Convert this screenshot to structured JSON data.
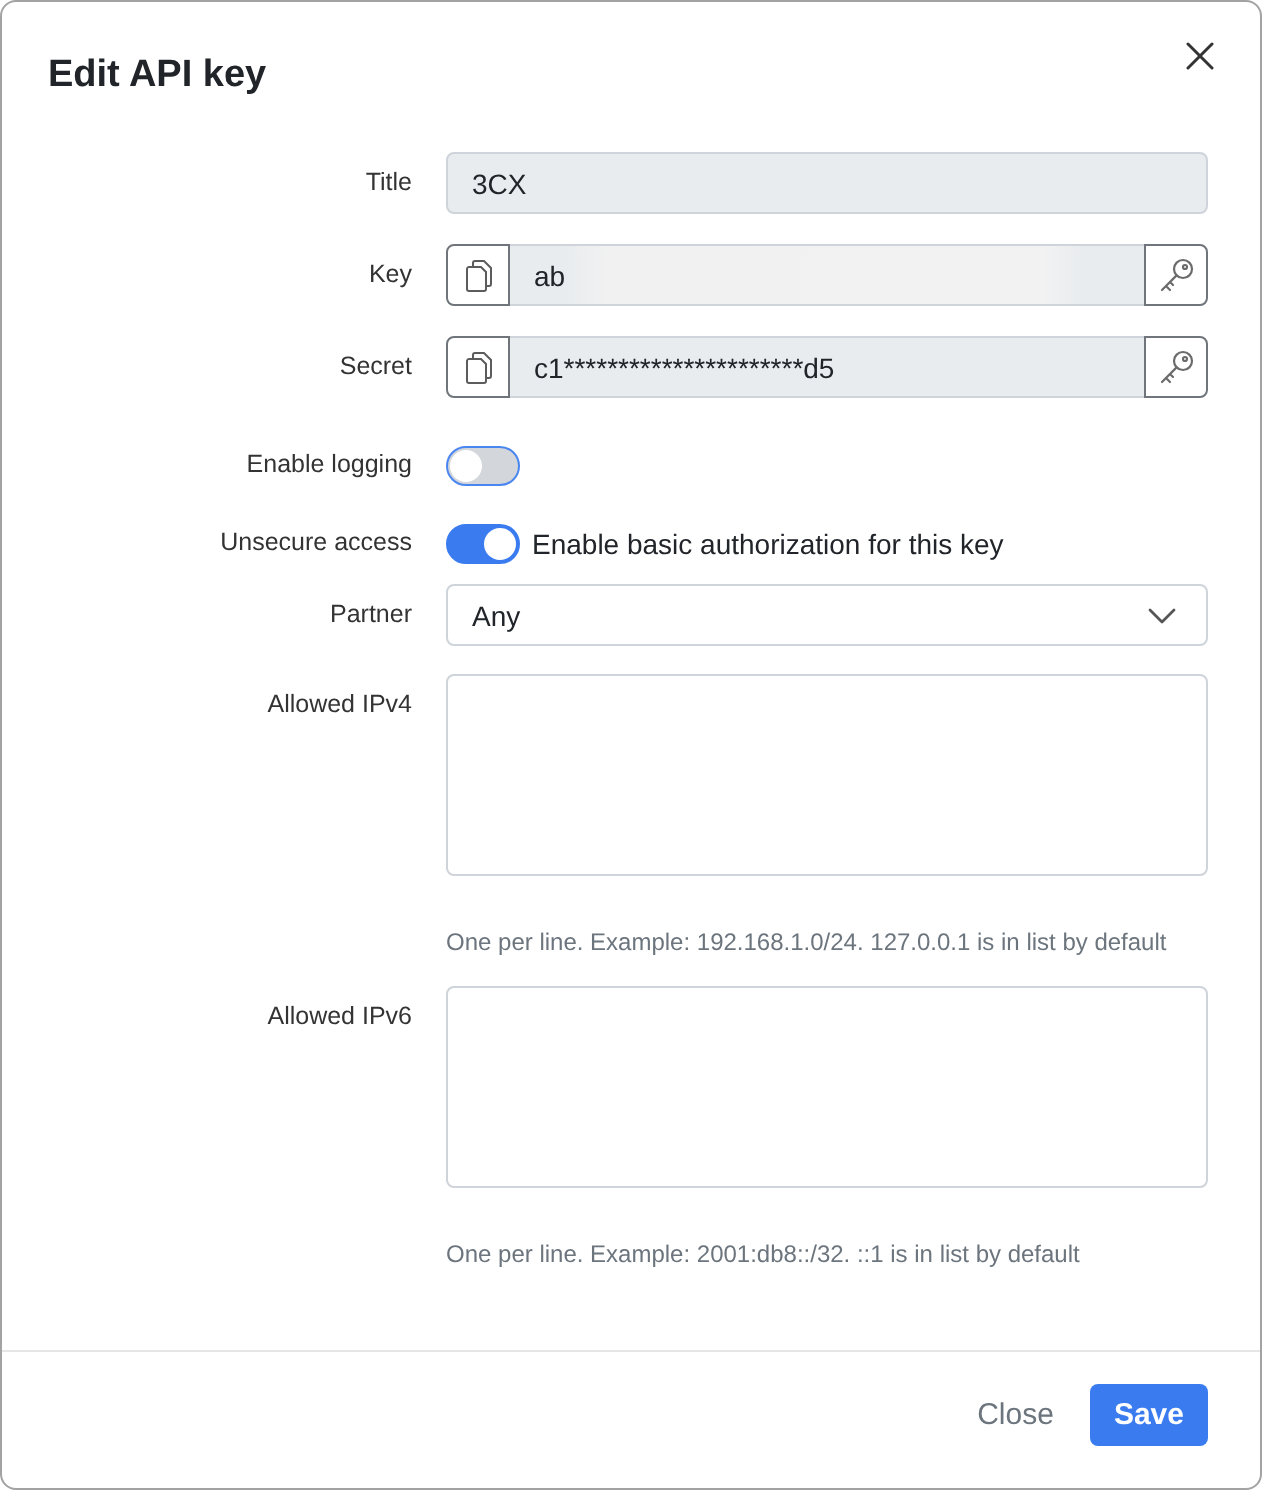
{
  "dialog": {
    "title": "Edit API key"
  },
  "fields": [
    {
      "kind": "text",
      "label": "Title",
      "value": "3CX",
      "disabled": true
    },
    {
      "kind": "secret",
      "label": "Key",
      "value": "ab",
      "disabled": true,
      "redacted": true
    },
    {
      "kind": "secret",
      "label": "Secret",
      "value": "c1**********************d5",
      "disabled": true
    },
    {
      "kind": "toggle",
      "label": "Enable logging",
      "on": false
    },
    {
      "kind": "toggle",
      "label": "Unsecure access",
      "on": true,
      "caption": "Enable basic authorization for this key"
    },
    {
      "kind": "select",
      "label": "Partner",
      "value": "Any"
    },
    {
      "kind": "textarea",
      "label": "Allowed IPv4",
      "help": "One per line. Example: 192.168.1.0/24. 127.0.0.1 is in list by default"
    },
    {
      "kind": "textarea",
      "label": "Allowed IPv6",
      "help": "One per line. Example: 2001:db8::/32. ::1 is in list by default"
    }
  ],
  "buttons": [
    {
      "kind": "secondary",
      "label": "Close"
    },
    {
      "kind": "primary",
      "label": "Save"
    }
  ]
}
